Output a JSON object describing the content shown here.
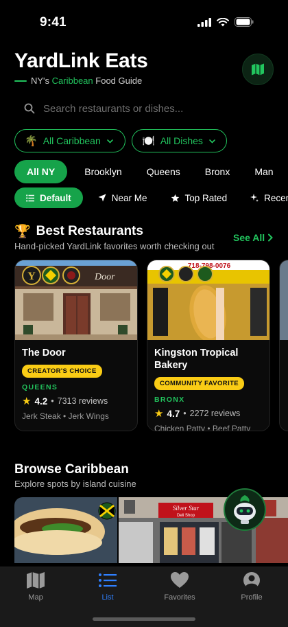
{
  "status": {
    "time": "9:41"
  },
  "header": {
    "title": "YardLink Eats",
    "subtitle_prefix": "NY's ",
    "subtitle_highlight": "Caribbean",
    "subtitle_suffix": " Food Guide"
  },
  "search": {
    "placeholder": "Search restaurants or dishes..."
  },
  "filters": {
    "cuisine": "All Caribbean",
    "cuisine_emoji": "🌴",
    "dishes": "All Dishes",
    "dishes_emoji": "🍽️"
  },
  "regions": [
    "All NY",
    "Brooklyn",
    "Queens",
    "Bronx",
    "Man"
  ],
  "sorts": [
    "Default",
    "Near Me",
    "Top Rated",
    "Recen"
  ],
  "best": {
    "title": "Best Restaurants",
    "emoji": "🏆",
    "subtitle": "Hand-picked YardLink favorites worth checking out",
    "see_all": "See All",
    "cards": [
      {
        "name": "The Door",
        "badge": "CREATOR'S CHOICE",
        "borough": "QUEENS",
        "rating": "4.2",
        "reviews": "7313 reviews",
        "dishes": "Jerk Steak • Jerk Wings",
        "sign": "Door"
      },
      {
        "name": "Kingston Tropical Bakery",
        "badge": "COMMUNITY FAVORITE",
        "borough": "BRONX",
        "rating": "4.7",
        "reviews": "2272 reviews",
        "dishes": "Chicken Patty • Beef Patty",
        "sign": "718-798-0076"
      }
    ]
  },
  "browse": {
    "title": "Browse Caribbean",
    "subtitle": "Explore spots by island cuisine",
    "shop_sign": "Silver Star Deli Shop"
  },
  "tabbar": [
    {
      "label": "Map",
      "icon": "map-icon"
    },
    {
      "label": "List",
      "icon": "list-icon",
      "active": true
    },
    {
      "label": "Favorites",
      "icon": "heart-icon"
    },
    {
      "label": "Profile",
      "icon": "profile-icon"
    }
  ],
  "colors": {
    "accent": "#22c55e",
    "badge": "#facc15",
    "active_tab": "#2f80ff"
  }
}
